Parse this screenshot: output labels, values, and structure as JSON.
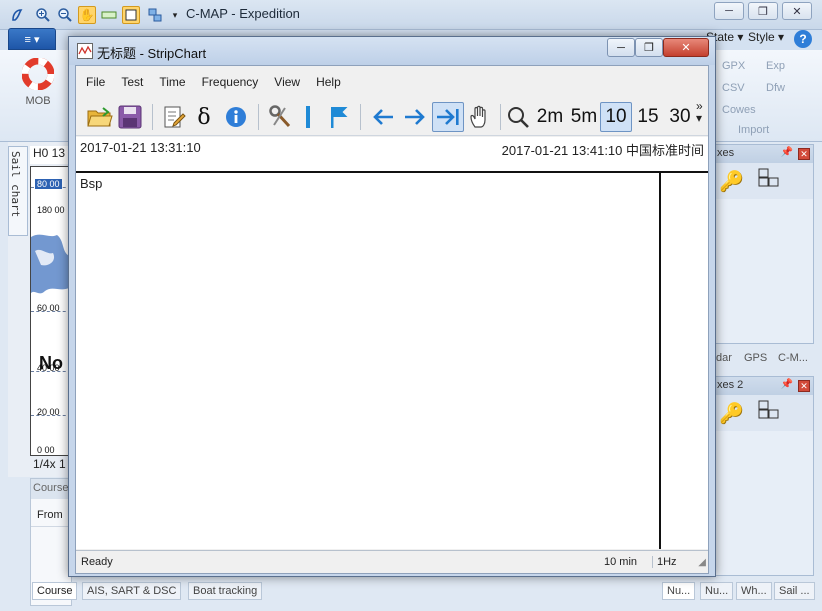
{
  "main_window": {
    "title": "C-MAP - Expedition",
    "file_button": "≡ ▾",
    "ribbon_tabs": [
      "State",
      "Style"
    ],
    "ribbon": {
      "mob_label": "MOB",
      "export_items": [
        "GPX",
        "Exp",
        "CSV",
        "Dfw",
        "Cowes"
      ],
      "import_label": "Import"
    }
  },
  "left_panel": {
    "sail_chart_tab": "Sail chart",
    "chart_header": "H0 13",
    "chart_labels": [
      "80 00",
      "180 00",
      "60 00",
      "No",
      "40 00",
      "20 00",
      "0 00"
    ],
    "scale_text": "1/4x 1",
    "course_header": "Course",
    "from_header": "From"
  },
  "bottom_tabs": [
    "Course",
    "AIS, SART & DSC",
    "Boat tracking",
    "Nu...",
    "Nu...",
    "Wh...",
    "Sail ..."
  ],
  "right_panels": {
    "panel1_title": "xes",
    "panel2_title": "xes 2",
    "mid_tabs": [
      "dar",
      "GPS",
      "C-M..."
    ]
  },
  "stripchart": {
    "title": "无标题 - StripChart",
    "menu": [
      "File",
      "Test",
      "Time",
      "Frequency",
      "View",
      "Help"
    ],
    "toolbar_ranges": [
      "2m",
      "5m",
      "10",
      "15",
      "30"
    ],
    "active_range": "10",
    "time_start": "2017-01-21 13:31:10",
    "time_end": "2017-01-21 13:41:10 中国标准时间",
    "series_label": "Bsp",
    "status": {
      "ready": "Ready",
      "span": "10 min",
      "freq": "1Hz"
    }
  },
  "colors": {
    "accent_blue": "#1e56a8",
    "window_frame": "#c6d6eb",
    "close_red": "#c4402e"
  }
}
